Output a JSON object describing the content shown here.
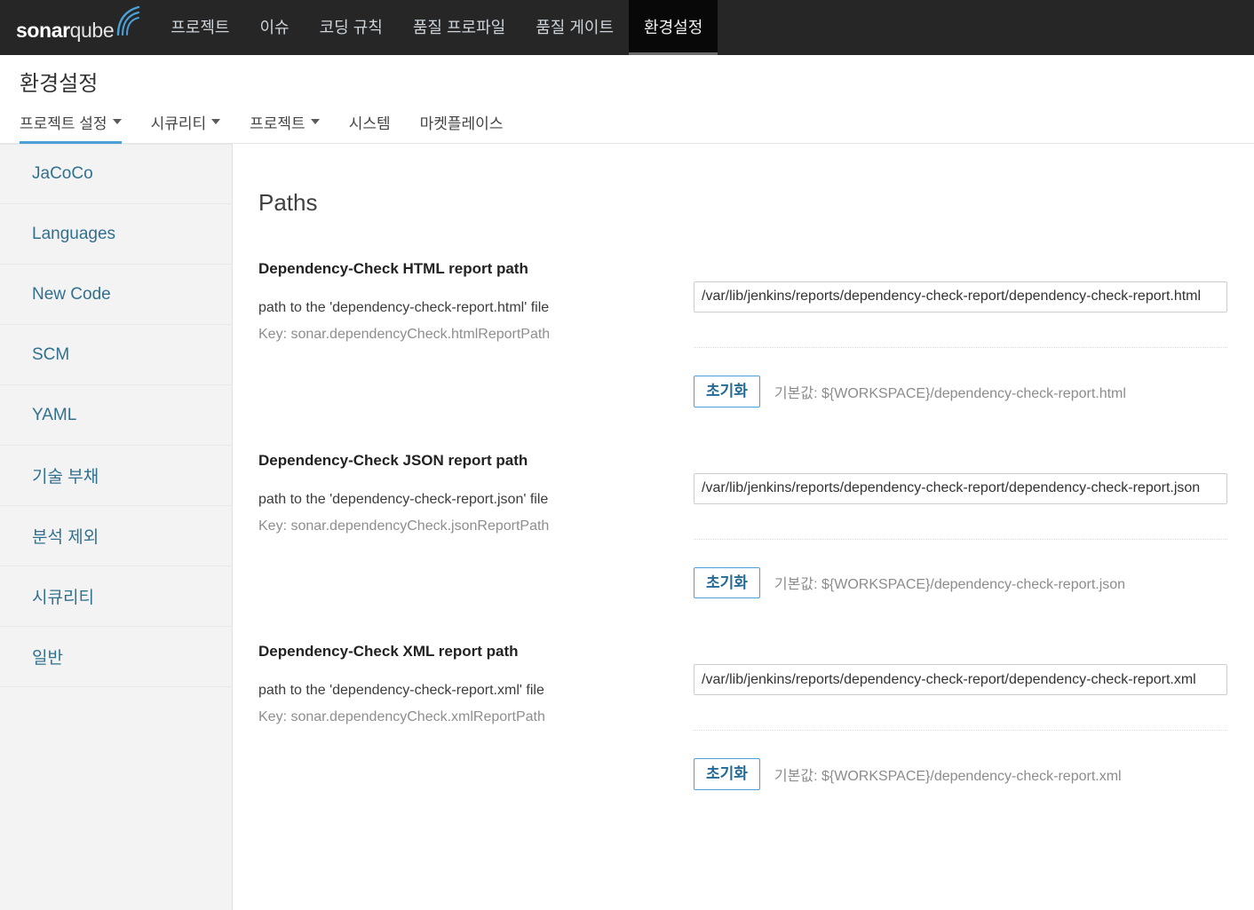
{
  "global_nav": {
    "logo": {
      "bold_part": "sonar",
      "light_part": "qube",
      "icon": "sonarqube-arcs-logo"
    },
    "items": [
      {
        "label": "프로젝트",
        "active": false
      },
      {
        "label": "이슈",
        "active": false
      },
      {
        "label": "코딩 규칙",
        "active": false
      },
      {
        "label": "품질 프로파일",
        "active": false
      },
      {
        "label": "품질 게이트",
        "active": false
      },
      {
        "label": "환경설정",
        "active": true
      }
    ]
  },
  "page": {
    "title": "환경설정"
  },
  "sub_nav": {
    "items": [
      {
        "label": "프로젝트 설정",
        "has_caret": true,
        "active": true
      },
      {
        "label": "시큐리티",
        "has_caret": true,
        "active": false
      },
      {
        "label": "프로젝트",
        "has_caret": true,
        "active": false
      },
      {
        "label": "시스템",
        "has_caret": false,
        "active": false
      },
      {
        "label": "마켓플레이스",
        "has_caret": false,
        "active": false
      }
    ]
  },
  "sidebar": {
    "items": [
      {
        "label": "JaCoCo"
      },
      {
        "label": "Languages"
      },
      {
        "label": "New Code"
      },
      {
        "label": "SCM"
      },
      {
        "label": "YAML"
      },
      {
        "label": "기술 부채"
      },
      {
        "label": "분석 제외"
      },
      {
        "label": "시큐리티"
      },
      {
        "label": "일반"
      }
    ]
  },
  "main": {
    "section_title": "Paths",
    "reset_label": "초기화",
    "settings": [
      {
        "name": "Dependency-Check HTML report path",
        "description": "path to the 'dependency-check-report.html' file",
        "key": "Key: sonar.dependencyCheck.htmlReportPath",
        "value": "/var/lib/jenkins/reports/dependency-check-report/dependency-check-report.html",
        "placeholder": "",
        "default": "기본값: ${WORKSPACE}/dependency-check-report.html"
      },
      {
        "name": "Dependency-Check JSON report path",
        "description": "path to the 'dependency-check-report.json' file",
        "key": "Key: sonar.dependencyCheck.jsonReportPath",
        "value": "/var/lib/jenkins/reports/dependency-check-report/dependency-check-report.json",
        "placeholder": "",
        "default": "기본값: ${WORKSPACE}/dependency-check-report.json"
      },
      {
        "name": "Dependency-Check XML report path",
        "description": "path to the 'dependency-check-report.xml' file",
        "key": "Key: sonar.dependencyCheck.xmlReportPath",
        "value": "/var/lib/jenkins/reports/dependency-check-report/dependency-check-report.xml",
        "placeholder": "",
        "default": "기본값: ${WORKSPACE}/dependency-check-report.xml"
      }
    ]
  },
  "colors": {
    "nav_background": "#262626",
    "nav_active_background": "#080808",
    "accent_blue": "#4b9fd5",
    "link_blue": "#31708f",
    "sidebar_background": "#f3f3f3"
  }
}
